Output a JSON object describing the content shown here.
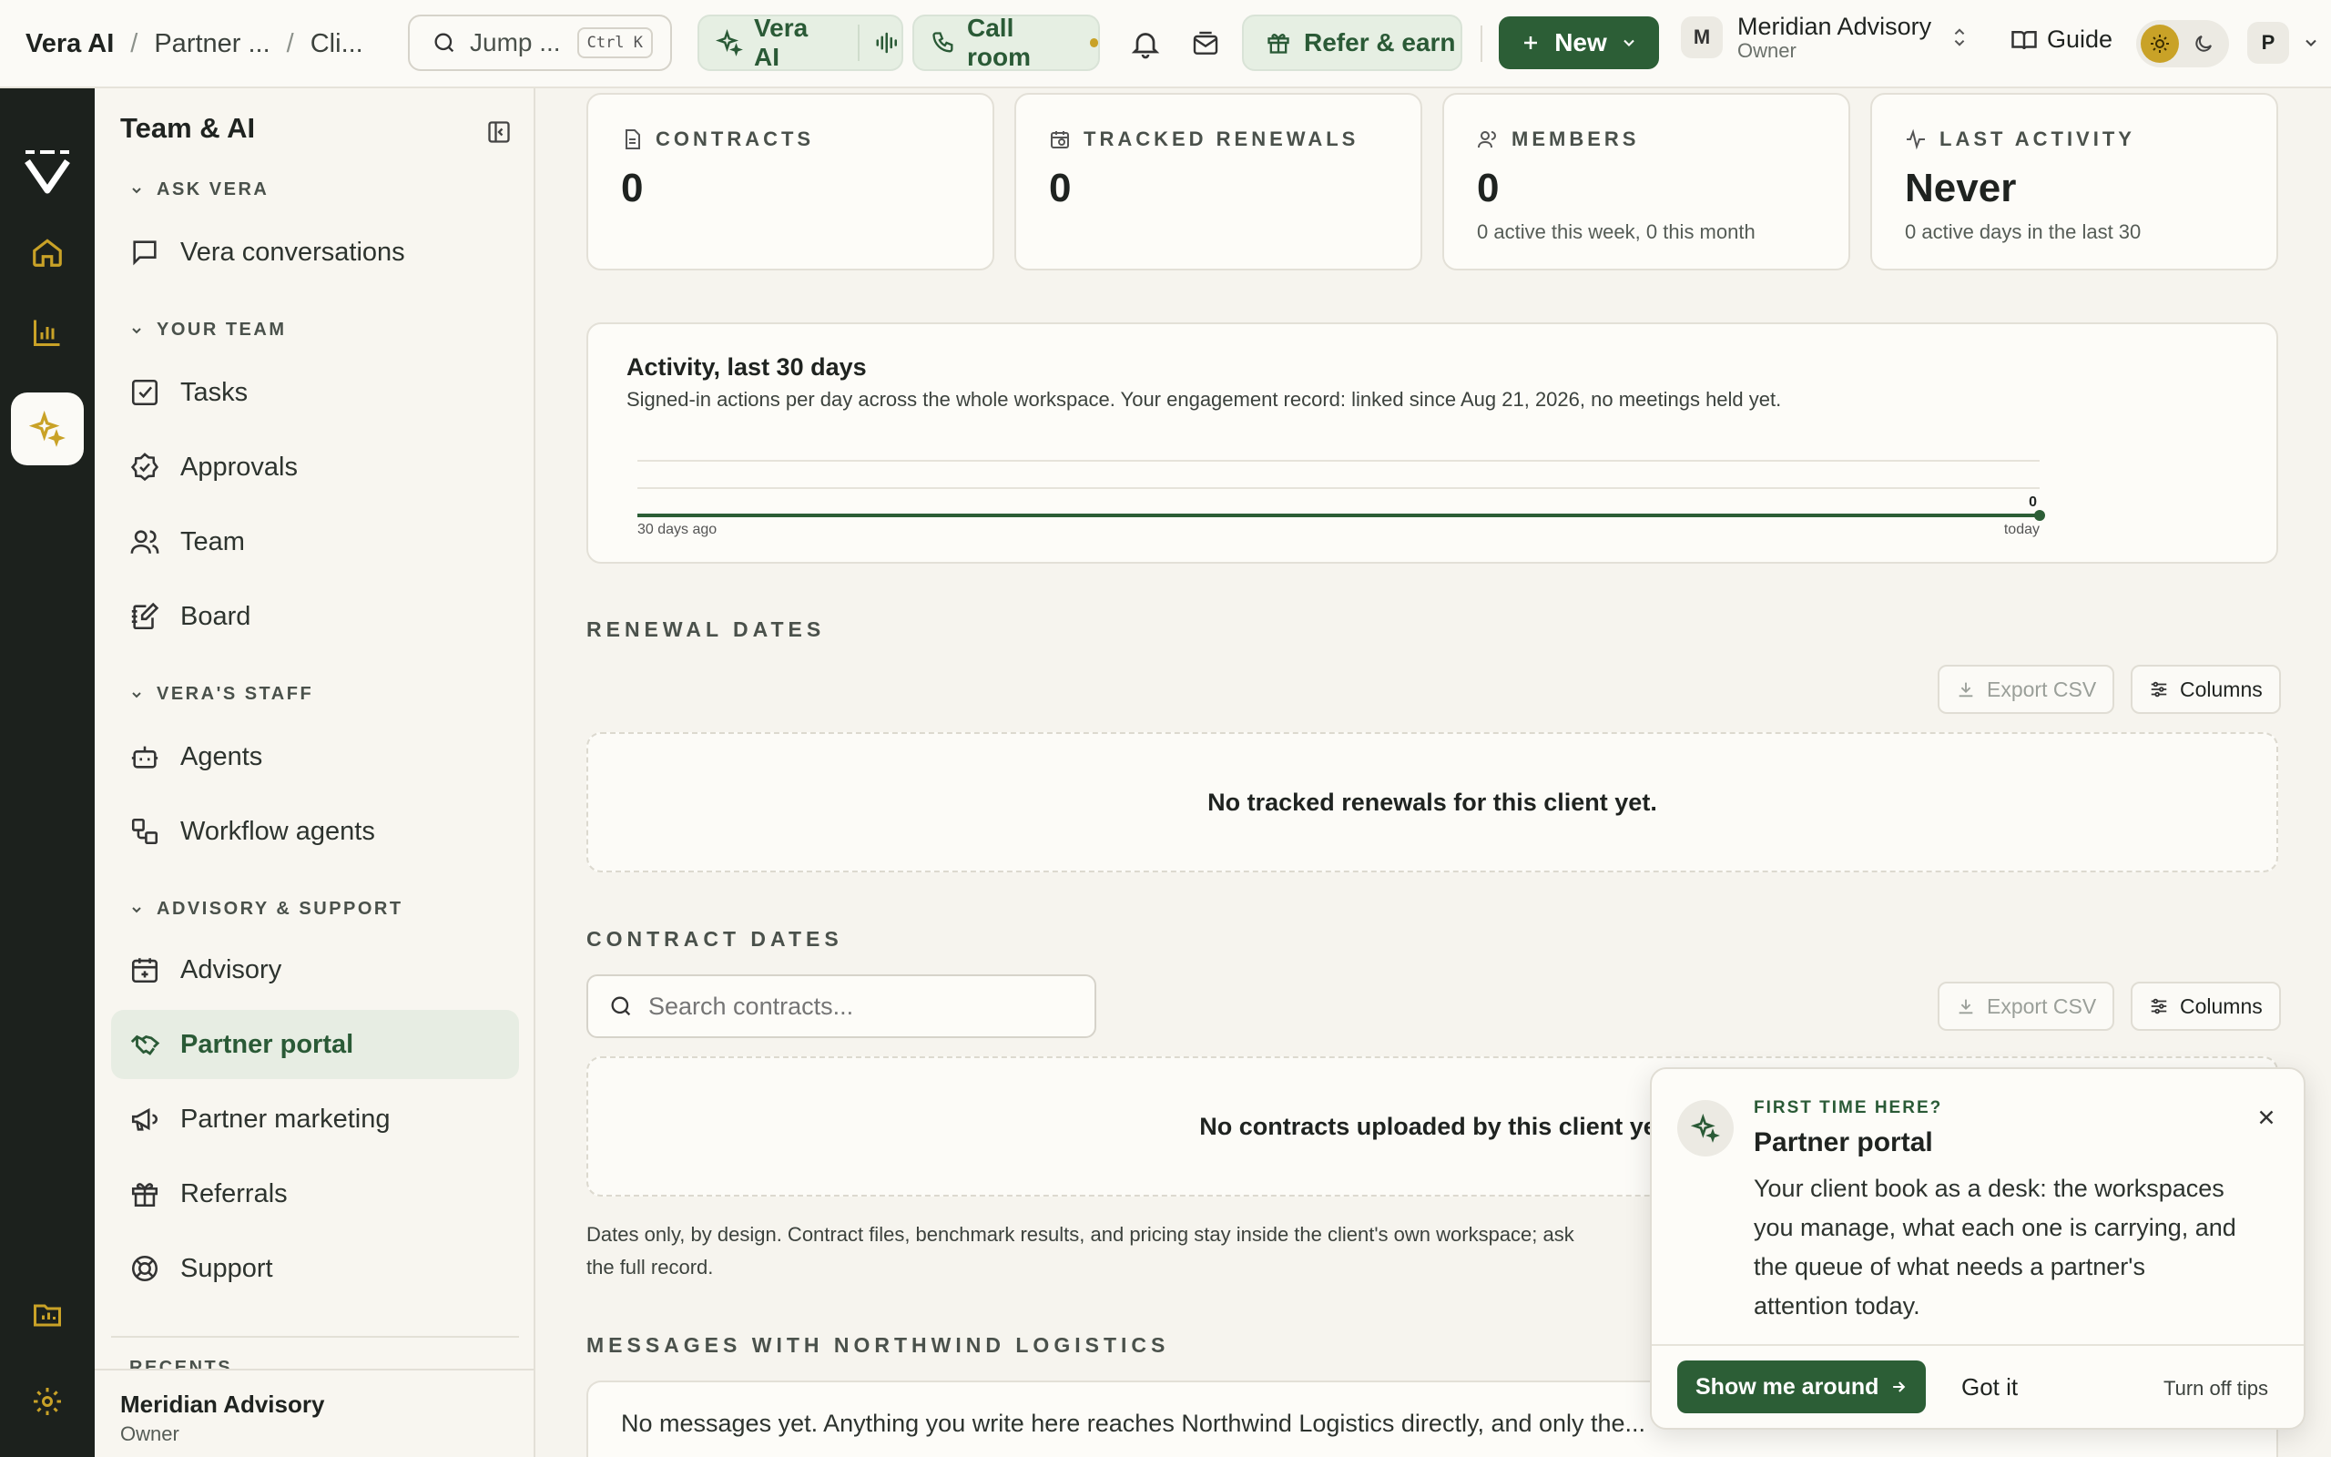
{
  "topbar": {
    "breadcrumb": [
      "Vera AI",
      "Partner ...",
      "Cli..."
    ],
    "jump_placeholder": "Jump ...",
    "jump_shortcut": "Ctrl K",
    "vera_ai_label": "Vera AI",
    "call_room_label": "Call room",
    "refer_label": "Refer & earn",
    "new_label": "New",
    "account_initial": "M",
    "account_name": "Meridian Advisory",
    "account_role": "Owner",
    "guide_label": "Guide",
    "user_initial": "P"
  },
  "sidebar": {
    "title": "Team & AI",
    "sections": {
      "ask_vera": "ASK VERA",
      "your_team": "YOUR TEAM",
      "veras_staff": "VERA'S STAFF",
      "advisory_support": "ADVISORY & SUPPORT",
      "recents": "RECENTS"
    },
    "items": {
      "vera_conversations": "Vera conversations",
      "tasks": "Tasks",
      "approvals": "Approvals",
      "team": "Team",
      "board": "Board",
      "agents": "Agents",
      "workflow_agents": "Workflow agents",
      "advisory": "Advisory",
      "partner_portal": "Partner portal",
      "partner_marketing": "Partner marketing",
      "referrals": "Referrals",
      "support": "Support"
    },
    "footer_name": "Meridian Advisory",
    "footer_role": "Owner"
  },
  "stats": [
    {
      "label": "CONTRACTS",
      "value": "0",
      "sub": ""
    },
    {
      "label": "TRACKED RENEWALS",
      "value": "0",
      "sub": ""
    },
    {
      "label": "MEMBERS",
      "value": "0",
      "sub": "0 active this week, 0 this month"
    },
    {
      "label": "LAST ACTIVITY",
      "value": "Never",
      "sub": "0 active days in the last 30"
    }
  ],
  "activity": {
    "title": "Activity, last 30 days",
    "description": "Signed-in actions per day across the whole workspace. Your engagement record: linked since Aug 21, 2026, no meetings held yet.",
    "start_label": "30 days ago",
    "end_label": "today",
    "last_value_label": "0"
  },
  "chart_data": {
    "type": "line",
    "x": [
      "30 days ago",
      "today"
    ],
    "series": [
      {
        "values": [
          0,
          0
        ]
      }
    ],
    "ylim": [
      0,
      1
    ],
    "grid": true
  },
  "renewals": {
    "heading": "RENEWAL DATES",
    "export_label": "Export CSV",
    "columns_label": "Columns",
    "empty_text": "No tracked renewals for this client yet."
  },
  "contracts": {
    "heading": "CONTRACT DATES",
    "search_placeholder": "Search contracts...",
    "export_label": "Export CSV",
    "columns_label": "Columns",
    "empty_text": "No contracts uploaded by this client yet",
    "note_line1": "Dates only, by design. Contract files, benchmark results, and pricing stay inside the client's own workspace; ask",
    "note_line2": "the full record."
  },
  "messages": {
    "heading": "MESSAGES WITH NORTHWIND LOGISTICS",
    "empty_text": "No messages yet. Anything you write here reaches Northwind Logistics directly, and only the..."
  },
  "tip": {
    "kicker": "FIRST TIME HERE?",
    "title": "Partner portal",
    "body": "Your client book as a desk: the workspaces you manage, what each one is carrying, and the queue of what needs a partner's attention today.",
    "primary_label": "Show me around",
    "secondary_label": "Got it",
    "tertiary_label": "Turn off tips"
  },
  "colors": {
    "accent": "#2c5e36",
    "rail": "#1c211d",
    "rail_accent": "#c9a227",
    "background": "#f6f4ee"
  }
}
